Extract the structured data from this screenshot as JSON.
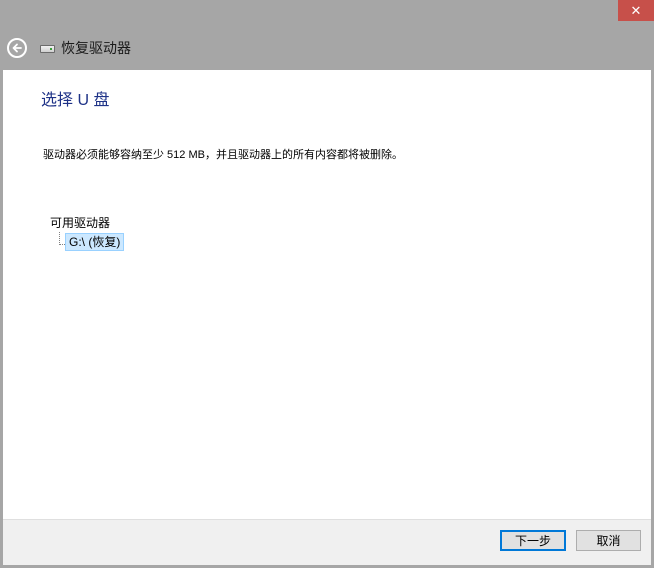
{
  "window": {
    "close_glyph": "✕",
    "back_icon": "back-arrow-icon",
    "drive_icon": "drive-icon",
    "title": "恢复驱动器"
  },
  "main": {
    "heading": "选择 U 盘",
    "description": "驱动器必须能够容纳至少 512 MB，并且驱动器上的所有内容都将被删除。",
    "tree": {
      "root_label": "可用驱动器",
      "items": [
        {
          "label": "G:\\ (恢复)",
          "selected": true
        }
      ]
    }
  },
  "footer": {
    "next_label": "下一步",
    "cancel_label": "取消"
  },
  "colors": {
    "close_button": "#c7504a",
    "heading": "#1e3287",
    "selection_bg": "#cce8ff",
    "selection_border": "#99d1ff",
    "default_button_border": "#0078d7"
  }
}
